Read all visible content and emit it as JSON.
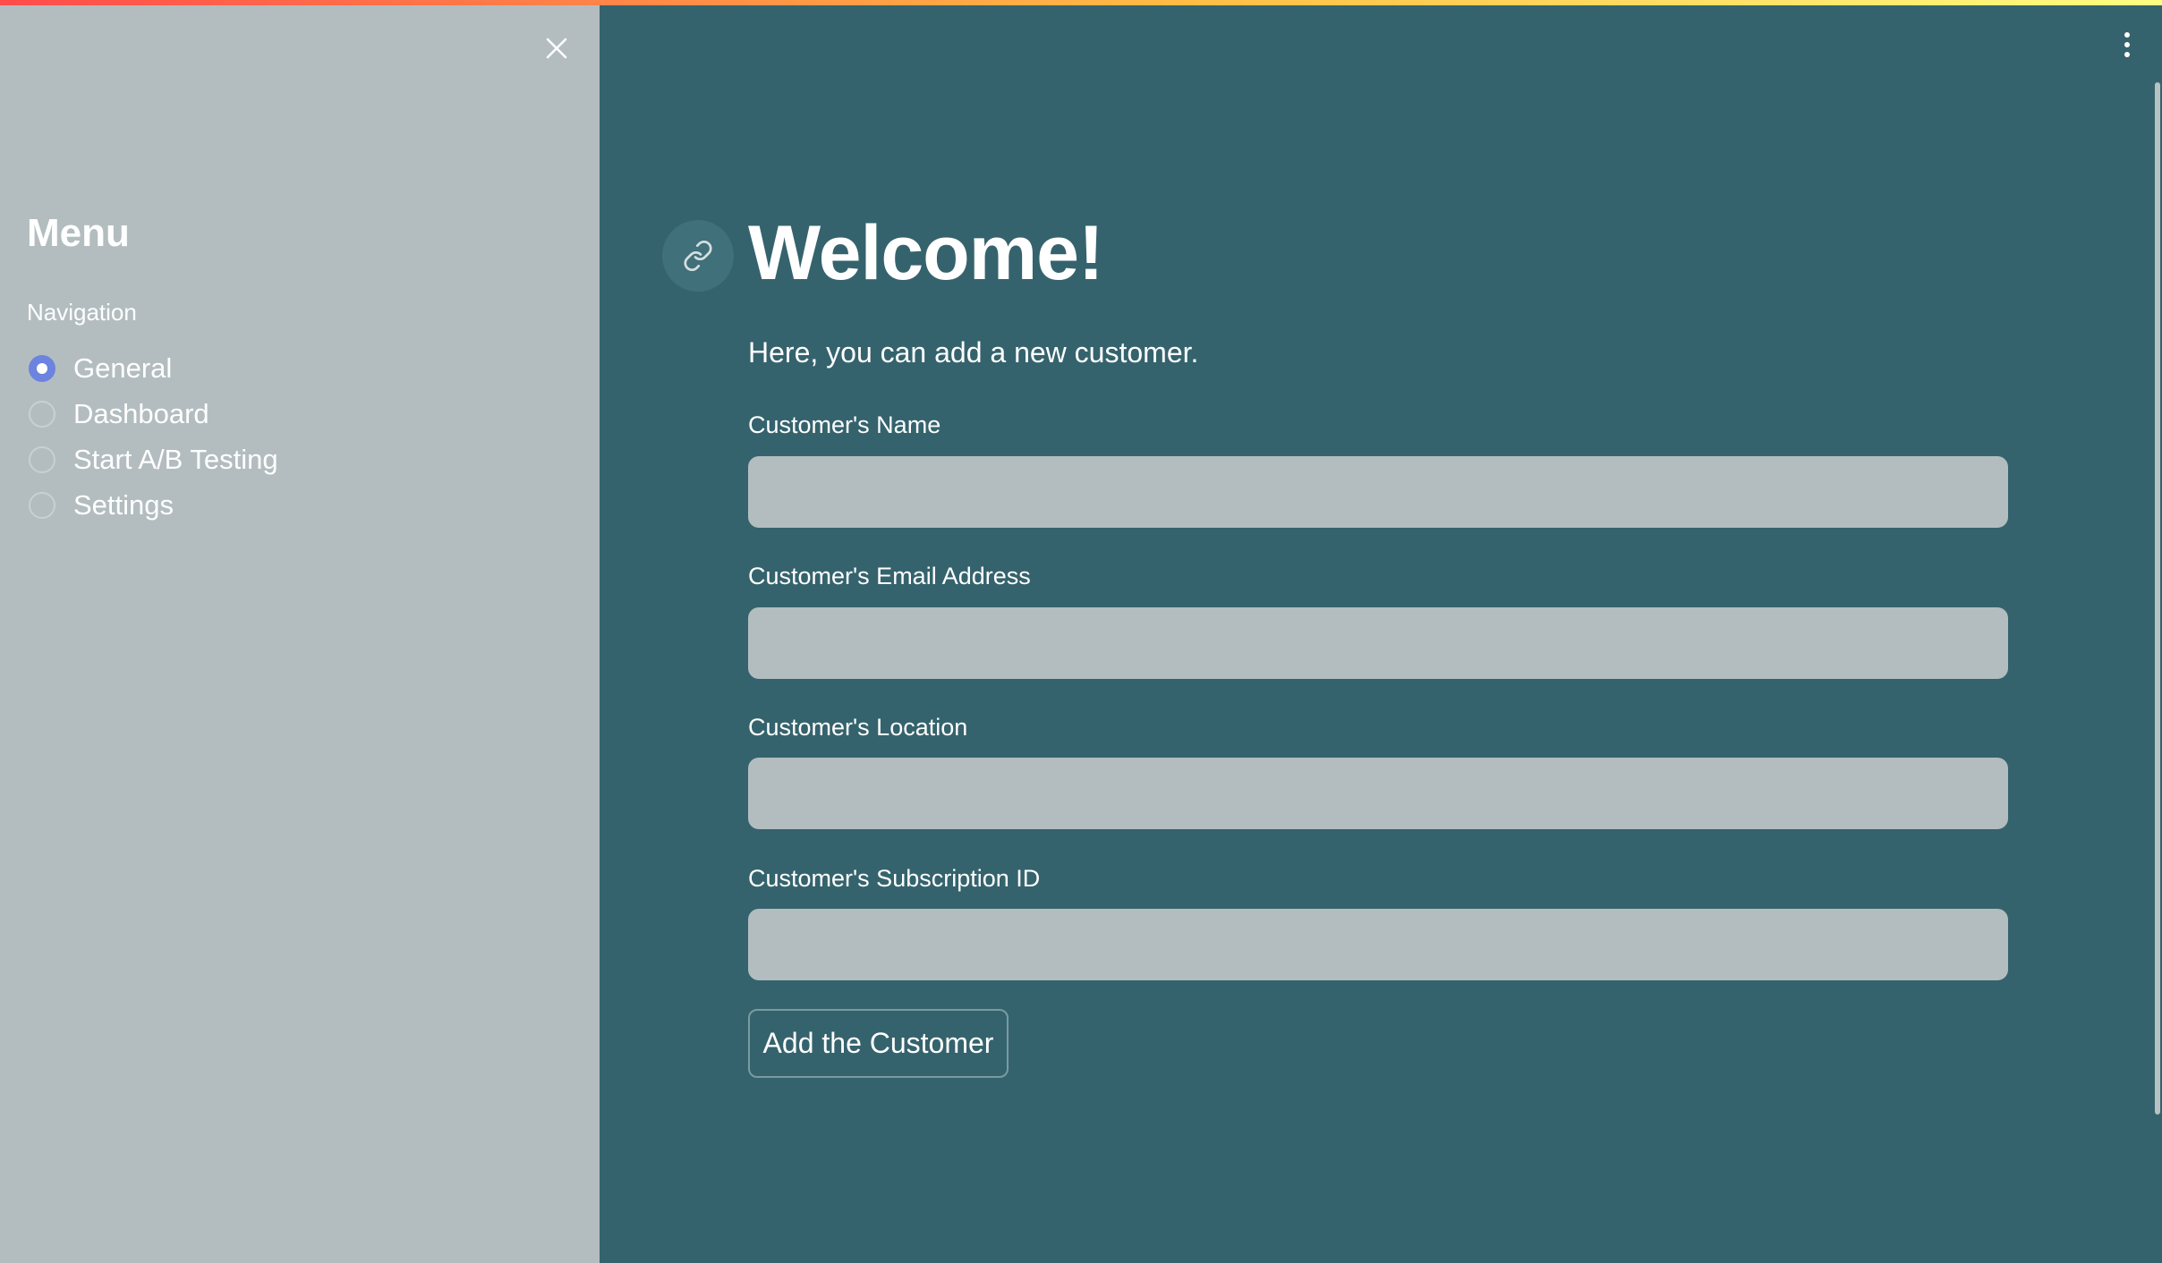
{
  "sidebar": {
    "title": "Menu",
    "nav_label": "Navigation",
    "items": [
      {
        "label": "General",
        "selected": true
      },
      {
        "label": "Dashboard",
        "selected": false
      },
      {
        "label": "Start A/B Testing",
        "selected": false
      },
      {
        "label": "Settings",
        "selected": false
      }
    ],
    "close_icon": "close-icon"
  },
  "main": {
    "title": "Welcome!",
    "subtitle": "Here, you can add a new customer.",
    "fields": [
      {
        "label": "Customer's Name",
        "value": ""
      },
      {
        "label": "Customer's Email Address",
        "value": ""
      },
      {
        "label": "Customer's Location",
        "value": ""
      },
      {
        "label": "Customer's Subscription ID",
        "value": ""
      }
    ],
    "submit_label": "Add the Customer"
  },
  "colors": {
    "sidebar_bg": "#b3bdc0",
    "main_bg": "#35636d",
    "accent": "#6c83df",
    "input_bg": "#b3bdc0"
  }
}
